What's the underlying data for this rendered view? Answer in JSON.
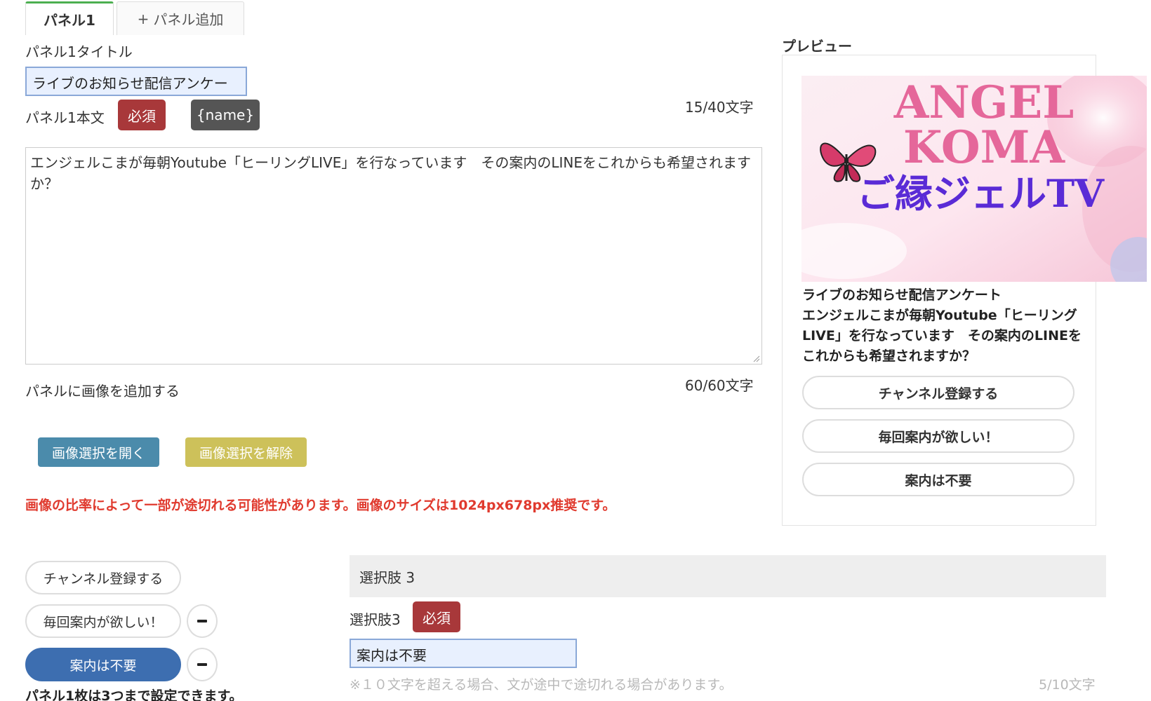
{
  "tabs": {
    "active": "パネル1",
    "add_label": "パネル追加"
  },
  "panel": {
    "title_label": "パネル1タイトル",
    "title_value": "ライブのお知らせ配信アンケー",
    "title_counter": "15/40文字",
    "body_label": "パネル1本文",
    "required_badge": "必須",
    "name_tag": "{name}",
    "body_value": "エンジェルこまが毎朝Youtube「ヒーリングLIVE」を行なっています　その案内のLINEをこれからも希望されますか？",
    "body_counter": "60/60文字",
    "image_label": "パネルに画像を追加する",
    "open_image_button": "画像選択を開く",
    "clear_image_button": "画像選択を解除",
    "image_warning": "画像の比率によって一部が途切れる可能性があります。画像のサイズは1024px678px推奨です。"
  },
  "preview": {
    "label": "プレビュー",
    "image_text_line1": "ANGEL",
    "image_text_line2": "KOMA",
    "image_text_line3": "ご縁ジェルTV",
    "title": "ライブのお知らせ配信アンケート",
    "body": "エンジェルこまが毎朝Youtube「ヒーリングLIVE」を行なっています　その案内のLINEをこれからも希望されますか？",
    "buttons": [
      "チャンネル登録する",
      "毎回案内が欲しい！",
      "案内は不要"
    ]
  },
  "choices": {
    "items": [
      "チャンネル登録する",
      "毎回案内が欲しい！",
      "案内は不要"
    ],
    "limit_note": "パネル1枚は3つまで設定できます。"
  },
  "choice_editor": {
    "header": "選択肢 3",
    "label": "選択肢3",
    "required_badge": "必須",
    "value": "案内は不要",
    "hint": "※１０文字を超える場合、文が途中で途切れる場合があります。",
    "counter": "5/10文字"
  },
  "colors": {
    "accent_green": "#4caf50",
    "required_red": "#a8383a",
    "warning_red": "#e03a2e",
    "active_blue": "#3d6eb0",
    "open_button": "#4b8bab",
    "clear_button": "#cdc15a"
  }
}
